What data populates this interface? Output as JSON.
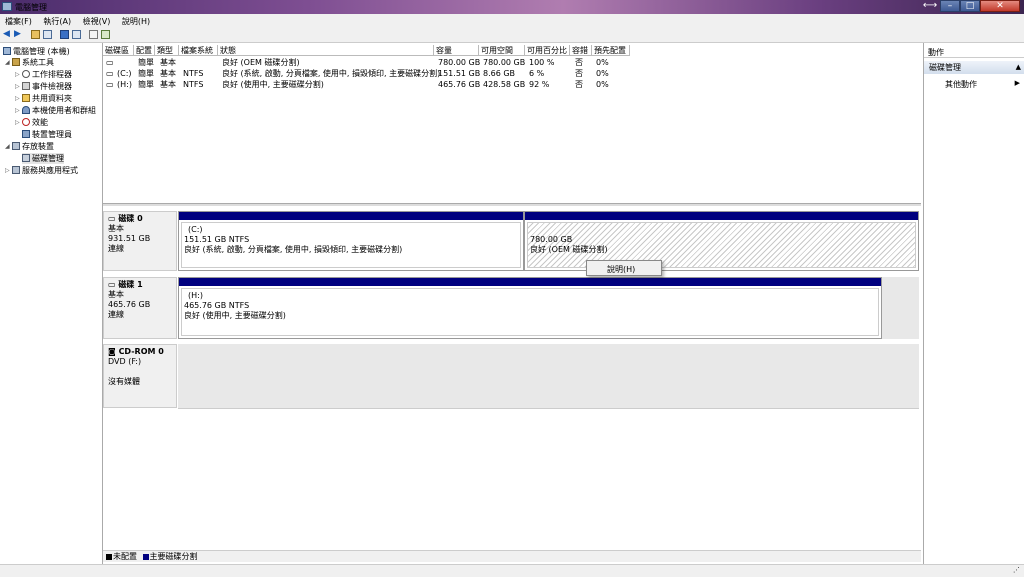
{
  "window": {
    "title": "電腦管理"
  },
  "menu": [
    "檔案(F)",
    "執行(A)",
    "檢視(V)",
    "說明(H)"
  ],
  "tree": {
    "root": "電腦管理 (本機)",
    "items": [
      {
        "label": "系統工具",
        "indent": 1,
        "expanded": true
      },
      {
        "label": "工作排程器",
        "indent": 2
      },
      {
        "label": "事件檢視器",
        "indent": 2
      },
      {
        "label": "共用資料夾",
        "indent": 2
      },
      {
        "label": "本機使用者和群組",
        "indent": 2
      },
      {
        "label": "效能",
        "indent": 2
      },
      {
        "label": "裝置管理員",
        "indent": 2
      },
      {
        "label": "存放裝置",
        "indent": 1,
        "expanded": true
      },
      {
        "label": "磁碟管理",
        "indent": 2,
        "selected": true
      },
      {
        "label": "服務與應用程式",
        "indent": 1
      }
    ]
  },
  "volume_list": {
    "headers": [
      "磁碟區",
      "配置",
      "類型",
      "檔案系統",
      "狀態",
      "容量",
      "可用空間",
      "可用百分比",
      "容錯",
      "預先配置"
    ],
    "rows": [
      [
        "",
        "簡單",
        "基本",
        "",
        "良好 (OEM 磁碟分割)",
        "780.00 GB",
        "780.00 GB",
        "100 %",
        "否",
        "0%"
      ],
      [
        "(C:)",
        "簡單",
        "基本",
        "NTFS",
        "良好 (系統, 啟動, 分頁檔案, 使用中, 損毀傾印, 主要磁碟分割)",
        "151.51 GB",
        "8.66 GB",
        "6 %",
        "否",
        "0%"
      ],
      [
        "(H:)",
        "簡單",
        "基本",
        "NTFS",
        "良好 (使用中, 主要磁碟分割)",
        "465.76 GB",
        "428.58 GB",
        "92 %",
        "否",
        "0%"
      ]
    ]
  },
  "disks": [
    {
      "name": "磁碟 0",
      "type": "基本",
      "size": "931.51 GB",
      "status": "連線",
      "partitions": [
        {
          "label": "(C:)",
          "size": "151.51 GB NTFS",
          "status": "良好 (系統, 啟動, 分頁檔案, 使用中, 損毀傾印, 主要磁碟分割)"
        },
        {
          "label": "",
          "size": "780.00 GB",
          "status": "良好 (OEM 磁碟分割)"
        }
      ]
    },
    {
      "name": "磁碟 1",
      "type": "基本",
      "size": "465.76 GB",
      "status": "連線",
      "partitions": [
        {
          "label": "(H:)",
          "size": "465.76 GB NTFS",
          "status": "良好 (使用中, 主要磁碟分割)"
        }
      ]
    },
    {
      "name": "CD-ROM 0",
      "type": "DVD (F:)",
      "size": "",
      "status": "沒有媒體"
    }
  ],
  "context_menu": {
    "item": "說明(H)"
  },
  "legend": [
    "未配置",
    "主要磁碟分割"
  ],
  "legend_colors": {
    "unallocated": "#000000",
    "primary": "#00007f"
  },
  "actions": {
    "header": "動作",
    "section": "磁碟管理",
    "item": "其他動作"
  }
}
